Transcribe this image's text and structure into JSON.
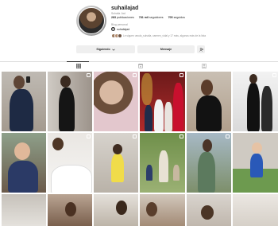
{
  "profile": {
    "username": "suhailajad",
    "subname": "Suhaila Jad",
    "stats": {
      "posts_count": "283",
      "posts_label": "publicaciones",
      "followers_count": "781 mil",
      "followers_label": "seguidores",
      "following_count": "705",
      "following_label": "seguidos"
    },
    "category": "Blog personal",
    "link": "suhailajad",
    "followed_by": "Le siguen ursula_suhaila, carmen_vidal y 17 más, algunos más de la lista"
  },
  "buttons": {
    "follow_label": "Siguiendo",
    "message_label": "Mensaje",
    "more_label": "+"
  },
  "tabs": [
    {
      "name": "posts",
      "icon": "grid-icon"
    },
    {
      "name": "reels",
      "icon": "reels-icon"
    },
    {
      "name": "tagged",
      "icon": "tagged-icon"
    }
  ],
  "colors": {
    "button_bg": "#efefef",
    "text_primary": "#262626",
    "text_secondary": "#8e8e8e",
    "divider": "#dbdbdb"
  },
  "grid_images": [
    {
      "row": 1,
      "col": 1,
      "description": "woman in jacket selfie in mirror"
    },
    {
      "row": 1,
      "col": 2,
      "description": "woman black outfit mirror selfie"
    },
    {
      "row": 1,
      "col": 3,
      "description": "woman smiling pink top close-up"
    },
    {
      "row": 1,
      "col": 4,
      "description": "family in red room with christmas decor"
    },
    {
      "row": 1,
      "col": 5,
      "description": "woman in black top posing"
    },
    {
      "row": 1,
      "col": 6,
      "description": "woman in black dress white room"
    },
    {
      "row": 2,
      "col": 1,
      "description": "child sitting outdoors"
    },
    {
      "row": 2,
      "col": 2,
      "description": "woman lying in bed with baby"
    },
    {
      "row": 2,
      "col": 3,
      "description": "woman in yellow dress mirror selfie"
    },
    {
      "row": 2,
      "col": 4,
      "description": "family walking in garden"
    },
    {
      "row": 2,
      "col": 5,
      "description": "woman in green dress outdoors"
    },
    {
      "row": 2,
      "col": 6,
      "description": "toddler in blue outfit on grass"
    }
  ]
}
